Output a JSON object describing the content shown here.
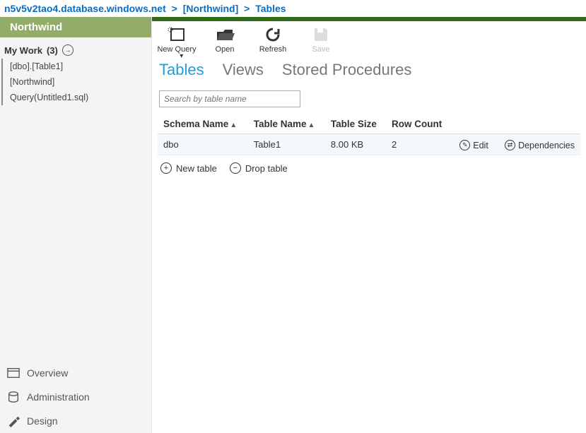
{
  "breadcrumb": {
    "server": "n5v5v2tao4.database.windows.net",
    "database": "[Northwind]",
    "section": "Tables"
  },
  "sidebar": {
    "title": "Northwind",
    "mywork_label": "My Work",
    "mywork_count": "(3)",
    "items": [
      {
        "label": "[dbo].[Table1]"
      },
      {
        "label": "[Northwind]"
      },
      {
        "label": "Query(Untitled1.sql)"
      }
    ],
    "nav": {
      "overview": "Overview",
      "administration": "Administration",
      "design": "Design"
    }
  },
  "toolbar": {
    "new_query": "New Query",
    "open": "Open",
    "refresh": "Refresh",
    "save": "Save"
  },
  "tabs": {
    "tables": "Tables",
    "views": "Views",
    "sprocs": "Stored Procedures"
  },
  "search": {
    "placeholder": "Search by table name"
  },
  "grid": {
    "columns": {
      "schema": "Schema Name",
      "table": "Table Name",
      "size": "Table Size",
      "rows": "Row Count"
    },
    "rows": [
      {
        "schema": "dbo",
        "table": "Table1",
        "size": "8.00 KB",
        "rows": "2"
      }
    ],
    "row_actions": {
      "edit": "Edit",
      "dependencies": "Dependencies"
    }
  },
  "under_actions": {
    "new_table": "New table",
    "drop_table": "Drop table"
  }
}
